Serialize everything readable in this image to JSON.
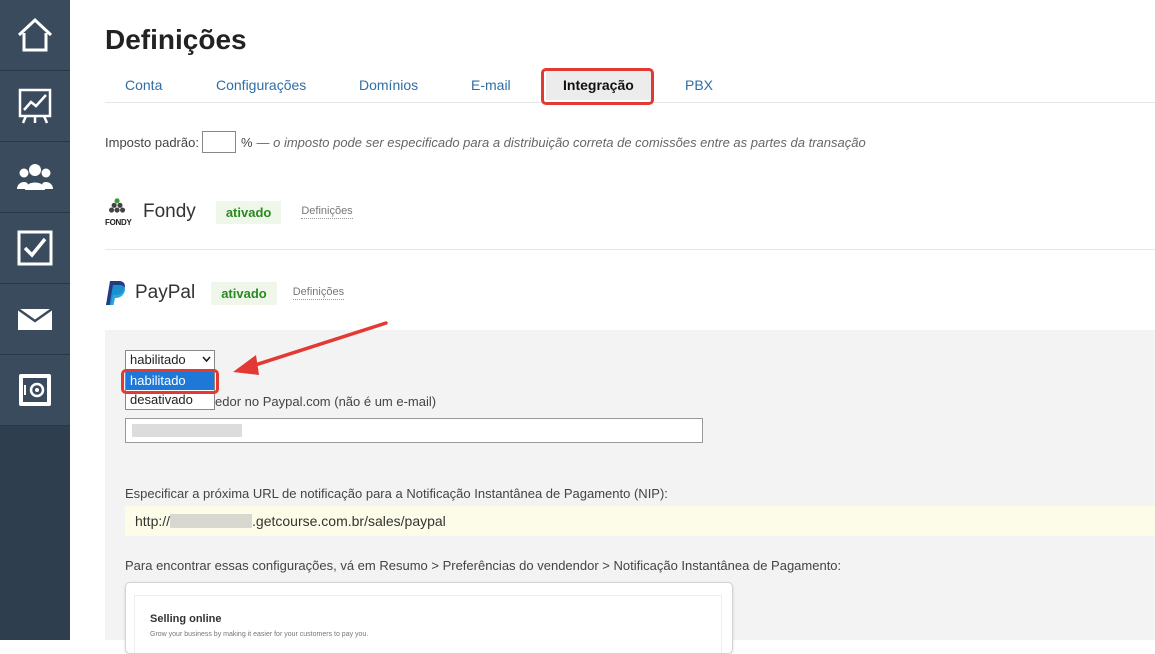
{
  "page": {
    "title": "Definições"
  },
  "tabs": [
    {
      "label": "Conta",
      "active": false
    },
    {
      "label": "Configurações",
      "active": false
    },
    {
      "label": "Domínios",
      "active": false
    },
    {
      "label": "E-mail",
      "active": false
    },
    {
      "label": "Integração",
      "active": true
    },
    {
      "label": "PBX",
      "active": false
    }
  ],
  "tax": {
    "label": "Imposto padrão:",
    "value": "",
    "unit": "%",
    "note": "— o imposto pode ser especificado para a distribuição correta de comissões entre as partes da transação"
  },
  "providers": {
    "fondy": {
      "logo_text": "FONDY",
      "name": "Fondy",
      "status": "ativado",
      "link": "Definições"
    },
    "paypal": {
      "name": "PayPal",
      "status": "ativado",
      "link": "Definições"
    }
  },
  "paypal_settings": {
    "select_value": "habilitado",
    "options": [
      "habilitado",
      "desativado"
    ],
    "seller_label_visible": "edor no Paypal.com (não é um e-mail)",
    "nip_label": "Especificar a próxima URL de notificação para a Notificação Instantânea de Pagamento (NIP):",
    "nip_url_prefix": "http://",
    "nip_url_suffix": ".getcourse.com.br/sales/paypal",
    "help_text": "Para encontrar essas configurações, vá em Resumo > Preferências do vendendor > Notificação Instantânea de Pagamento:",
    "shot_title": "Selling online",
    "shot_subtitle": "Grow your business by making it easier for your customers to pay you."
  },
  "colors": {
    "sidebar": "#2e3e4f",
    "highlight": "#e23a33",
    "link": "#2f6ea5",
    "badge_text": "#2a8a1f",
    "selected_option": "#1e78d8"
  },
  "sidebar_icons": [
    "home-icon",
    "chart-icon",
    "users-icon",
    "checkbox-icon",
    "mail-icon",
    "safe-icon"
  ]
}
